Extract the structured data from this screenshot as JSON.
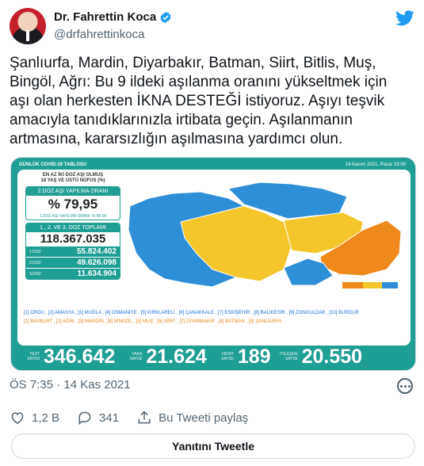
{
  "author": {
    "name": "Dr. Fahrettin Koca",
    "handle": "@drfahrettinkoca"
  },
  "tweet_text": "Şanlıurfa, Mardin, Diyarbakır, Batman, Siirt, Bitlis, Muş,\nBingöl, Ağrı: Bu 9 ildeki aşılanma oranını yükseltmek için\naşı olan herkesten İKNA DESTEĞİ istiyoruz. Aşıyı teşvik\namacıyla tanıdıklarınızla irtibata geçin. Aşılanmanın\nartmasına, kararsızlığın aşılmasına yardımcı olun.",
  "media": {
    "title": "GÜNLÜK COVID-19 TABLOSU",
    "date": "14 Kasım 2021, Pazar 19:00",
    "panel_head": "EN AZ İKİ DOZ AŞI OLMUŞ\n18 YAŞ VE ÜSTÜ NÜFUS (%)",
    "dose2_label": "2.DOZ AŞI YAPILMA ORANI",
    "dose2_value": "% 79,95",
    "dose1_label": "1.DOZ AŞI YAPILMA ORANI: % 89,94",
    "total_label": "1., 2. VE 3. DOZ TOPLAMI",
    "total_value": "118.367.035",
    "doses": [
      {
        "label": "1.DOZ",
        "value": "55.824.402"
      },
      {
        "label": "2.DOZ",
        "value": "49.626.098"
      },
      {
        "label": "3.DOZ",
        "value": "11.634.904"
      }
    ],
    "legend_blue": "[1] ORDU , [2] AMASYA , [3] MUĞLA , [4] OSMANİYE , [5] KIRKLARELİ , [6] ÇANAKKALE , [7] ESKİŞEHİR , [8] BALIKESİR , [9] ZONGULDAK , [10] BURDUR",
    "legend_orange": "[1] BAYBURT , [2] AĞRI , [3] MARDİN , [4] BİNGÖL , [5] MUŞ , [6] SİİRT , [7] DİYARBAKIR , [8] BATMAN , [9] ŞANLIURFA",
    "bottom": [
      {
        "label": "TEST SAYISI",
        "value": "346.642"
      },
      {
        "label": "VAKA SAYISI",
        "value": "21.624"
      },
      {
        "label": "VEFAT SAYISI",
        "value": "189"
      },
      {
        "label": "İYİLEŞEN SAYISI",
        "value": "20.550"
      }
    ],
    "colors": {
      "teal": "#1f9e93",
      "blue": "#2f8fd6",
      "yellow": "#f4c62b",
      "orange": "#ee8a1c"
    }
  },
  "timestamp": "ÖS 7:35 · 14 Kas 2021",
  "actions": {
    "likes": "1,2 B",
    "replies": "341",
    "share": "Bu Tweeti paylaş"
  },
  "reply_button": "Yanıtını Tweetle"
}
